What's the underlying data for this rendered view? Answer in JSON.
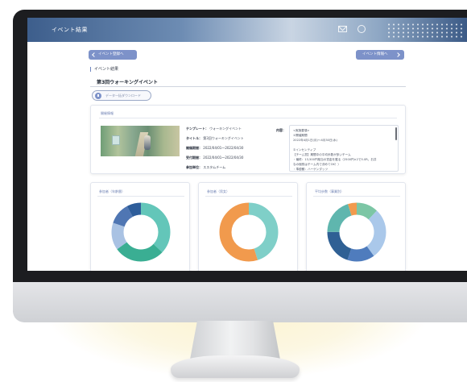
{
  "topbar": {
    "title": "イベント結果",
    "icons": [
      "mail-icon",
      "user-icon"
    ]
  },
  "nav": {
    "back_label": "イベント登録へ",
    "next_label": "イベント情報へ"
  },
  "page": {
    "section_label": "イベント結果",
    "event_title": "第3回ウォーキングイベント",
    "download_label": "データ一括ダウンロード"
  },
  "info": {
    "heading": "開催情報",
    "fields": [
      {
        "key": "テンプレート：",
        "value": "ウォーキングイベント"
      },
      {
        "key": "タイトル：",
        "value": "第3回ウォーキングイベント"
      },
      {
        "key": "開催期間：",
        "value": "2022/04/01〜2022/04/30"
      },
      {
        "key": "受付期間：",
        "value": "2022/04/01〜2022/04/30"
      },
      {
        "key": "参加単位：",
        "value": "ススタムチーム"
      }
    ],
    "description_label": "内容：",
    "description_lines": [
      "<実施要項>",
      "①開催期間",
      "2022年4月1日(月)〜4月30日(水)",
      "",
      "②インセンティブ",
      "【チーム賞】期間中の平均歩数が多いチーム",
      "・最終：13,500円相当の賞金を獲る（2500円×2で5.0R。お并",
      "なの個別はチーム内で決めてOK！）",
      "・準優勝：ハーゲンダッツ"
    ]
  },
  "charts": [
    {
      "title": "参加者（年齢層）",
      "colors": [
        "#63c6b9",
        "#3aae93",
        "#a9c2e3",
        "#4f76b3",
        "#2e5d9a"
      ]
    },
    {
      "title": "参加者（男女）",
      "colors": [
        "#7fcfc8",
        "#f19a4d"
      ]
    },
    {
      "title": "平均歩数（事業別）",
      "colors": [
        "#7cc6a5",
        "#aac8ea",
        "#4f7cbd",
        "#2f6094",
        "#5fb6ae",
        "#f19a4d"
      ]
    }
  ],
  "chart_data": [
    {
      "type": "pie",
      "title": "参加者（年齢層）",
      "values": [
        37,
        28,
        15,
        12,
        8
      ]
    },
    {
      "type": "pie",
      "title": "参加者（男女）",
      "values": [
        45,
        55
      ]
    },
    {
      "type": "pie",
      "title": "平均歩数（事業別）",
      "values": [
        12,
        28,
        15,
        20,
        20,
        5
      ]
    }
  ]
}
